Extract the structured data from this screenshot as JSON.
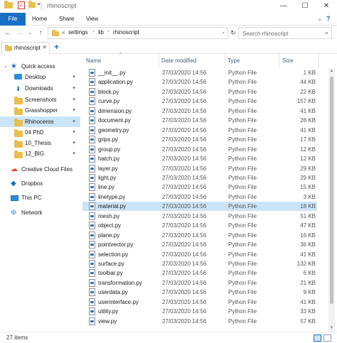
{
  "window": {
    "title": "rhinoscript",
    "minimize_glyph": "—",
    "maximize_glyph": "☐",
    "close_glyph": "✕"
  },
  "ribbon": {
    "tabs": [
      "File",
      "Home",
      "Share",
      "View"
    ],
    "collapse_glyph": "⌄",
    "help_glyph": "?"
  },
  "navigation": {
    "back_glyph": "←",
    "forward_glyph": "→",
    "recent_glyph": "⌄",
    "up_glyph": "↑",
    "refresh_glyph": "↻"
  },
  "address": {
    "overflow": "«",
    "crumbs": [
      "settings",
      "lib",
      "rhinoscript"
    ],
    "separator": "›",
    "dropdown_glyph": "⌄"
  },
  "search": {
    "placeholder": "Search rhinoscript",
    "icon": "search-icon"
  },
  "folder_tabs": {
    "active_label": "rhinoscript",
    "close_glyph": "✕",
    "new_tab_glyph": "+"
  },
  "nav_pane": {
    "items": [
      {
        "label": "Quick access",
        "icon": "star-icon",
        "pinned": false,
        "selected": false
      },
      {
        "label": "Desktop",
        "icon": "desktop-icon",
        "pinned": true,
        "selected": false
      },
      {
        "label": "Downloads",
        "icon": "downloads-icon",
        "pinned": true,
        "selected": false
      },
      {
        "label": "Screenshots",
        "icon": "folder-icon",
        "pinned": true,
        "selected": false
      },
      {
        "label": "Grasshopper",
        "icon": "folder-icon",
        "pinned": true,
        "selected": false
      },
      {
        "label": "Rhinoceros",
        "icon": "folder-icon",
        "pinned": true,
        "selected": true
      },
      {
        "label": "04 PhD",
        "icon": "folder-icon",
        "pinned": true,
        "selected": false
      },
      {
        "label": "10_Thesis",
        "icon": "folder-icon",
        "pinned": true,
        "selected": false
      },
      {
        "label": "12_BIG",
        "icon": "folder-icon",
        "pinned": true,
        "selected": false
      },
      {
        "label": "Creative Cloud Files",
        "icon": "creative-cloud-icon",
        "pinned": false,
        "selected": false
      },
      {
        "label": "Dropbox",
        "icon": "dropbox-icon",
        "pinned": false,
        "selected": false
      },
      {
        "label": "This PC",
        "icon": "computer-icon",
        "pinned": false,
        "selected": false
      },
      {
        "label": "Network",
        "icon": "network-icon",
        "pinned": false,
        "selected": false
      }
    ],
    "pin_glyph": "📌"
  },
  "columns": {
    "name": "Name",
    "date": "Date modified",
    "type": "Type",
    "size": "Size",
    "sort_glyph": "^"
  },
  "files": [
    {
      "name": "__init__.py",
      "date": "27/03/2020 14:56",
      "type": "Python File",
      "size": "1 KB"
    },
    {
      "name": "application.py",
      "date": "27/03/2020 14:56",
      "type": "Python File",
      "size": "44 KB"
    },
    {
      "name": "block.py",
      "date": "27/03/2020 14:56",
      "type": "Python File",
      "size": "22 KB"
    },
    {
      "name": "curve.py",
      "date": "27/03/2020 14:56",
      "type": "Python File",
      "size": "157 KB"
    },
    {
      "name": "dimension.py",
      "date": "27/03/2020 14:56",
      "type": "Python File",
      "size": "41 KB"
    },
    {
      "name": "document.py",
      "date": "27/03/2020 14:56",
      "type": "Python File",
      "size": "28 KB"
    },
    {
      "name": "geometry.py",
      "date": "27/03/2020 14:56",
      "type": "Python File",
      "size": "41 KB"
    },
    {
      "name": "grips.py",
      "date": "27/03/2020 14:56",
      "type": "Python File",
      "size": "17 KB"
    },
    {
      "name": "group.py",
      "date": "27/03/2020 14:56",
      "type": "Python File",
      "size": "12 KB"
    },
    {
      "name": "hatch.py",
      "date": "27/03/2020 14:56",
      "type": "Python File",
      "size": "12 KB"
    },
    {
      "name": "layer.py",
      "date": "27/03/2020 14:56",
      "type": "Python File",
      "size": "29 KB"
    },
    {
      "name": "light.py",
      "date": "27/03/2020 14:56",
      "type": "Python File",
      "size": "29 KB"
    },
    {
      "name": "line.py",
      "date": "27/03/2020 14:56",
      "type": "Python File",
      "size": "15 KB"
    },
    {
      "name": "linetype.py",
      "date": "27/03/2020 14:56",
      "type": "Python File",
      "size": "3 KB"
    },
    {
      "name": "material.py",
      "date": "27/03/2020 14:56",
      "type": "Python File",
      "size": "18 KB"
    },
    {
      "name": "mesh.py",
      "date": "27/03/2020 14:56",
      "type": "Python File",
      "size": "51 KB"
    },
    {
      "name": "object.py",
      "date": "27/03/2020 14:56",
      "type": "Python File",
      "size": "47 KB"
    },
    {
      "name": "plane.py",
      "date": "27/03/2020 14:56",
      "type": "Python File",
      "size": "16 KB"
    },
    {
      "name": "pointvector.py",
      "date": "27/03/2020 14:56",
      "type": "Python File",
      "size": "36 KB"
    },
    {
      "name": "selection.py",
      "date": "27/03/2020 14:56",
      "type": "Python File",
      "size": "41 KB"
    },
    {
      "name": "surface.py",
      "date": "27/03/2020 14:56",
      "type": "Python File",
      "size": "132 KB"
    },
    {
      "name": "toolbar.py",
      "date": "27/03/2020 14:56",
      "type": "Python File",
      "size": "6 KB"
    },
    {
      "name": "transformation.py",
      "date": "27/03/2020 14:56",
      "type": "Python File",
      "size": "21 KB"
    },
    {
      "name": "userdata.py",
      "date": "27/03/2020 14:56",
      "type": "Python File",
      "size": "9 KB"
    },
    {
      "name": "userinterface.py",
      "date": "27/03/2020 14:56",
      "type": "Python File",
      "size": "41 KB"
    },
    {
      "name": "utility.py",
      "date": "27/03/2020 14:56",
      "type": "Python File",
      "size": "33 KB"
    },
    {
      "name": "view.py",
      "date": "27/03/2020 14:56",
      "type": "Python File",
      "size": "57 KB"
    }
  ],
  "selected_file": "material.py",
  "status": {
    "item_count": "27 items"
  },
  "colors": {
    "accent": "#1a6fc4",
    "selection": "#cce4f7",
    "folder": "#e8bf4f"
  }
}
